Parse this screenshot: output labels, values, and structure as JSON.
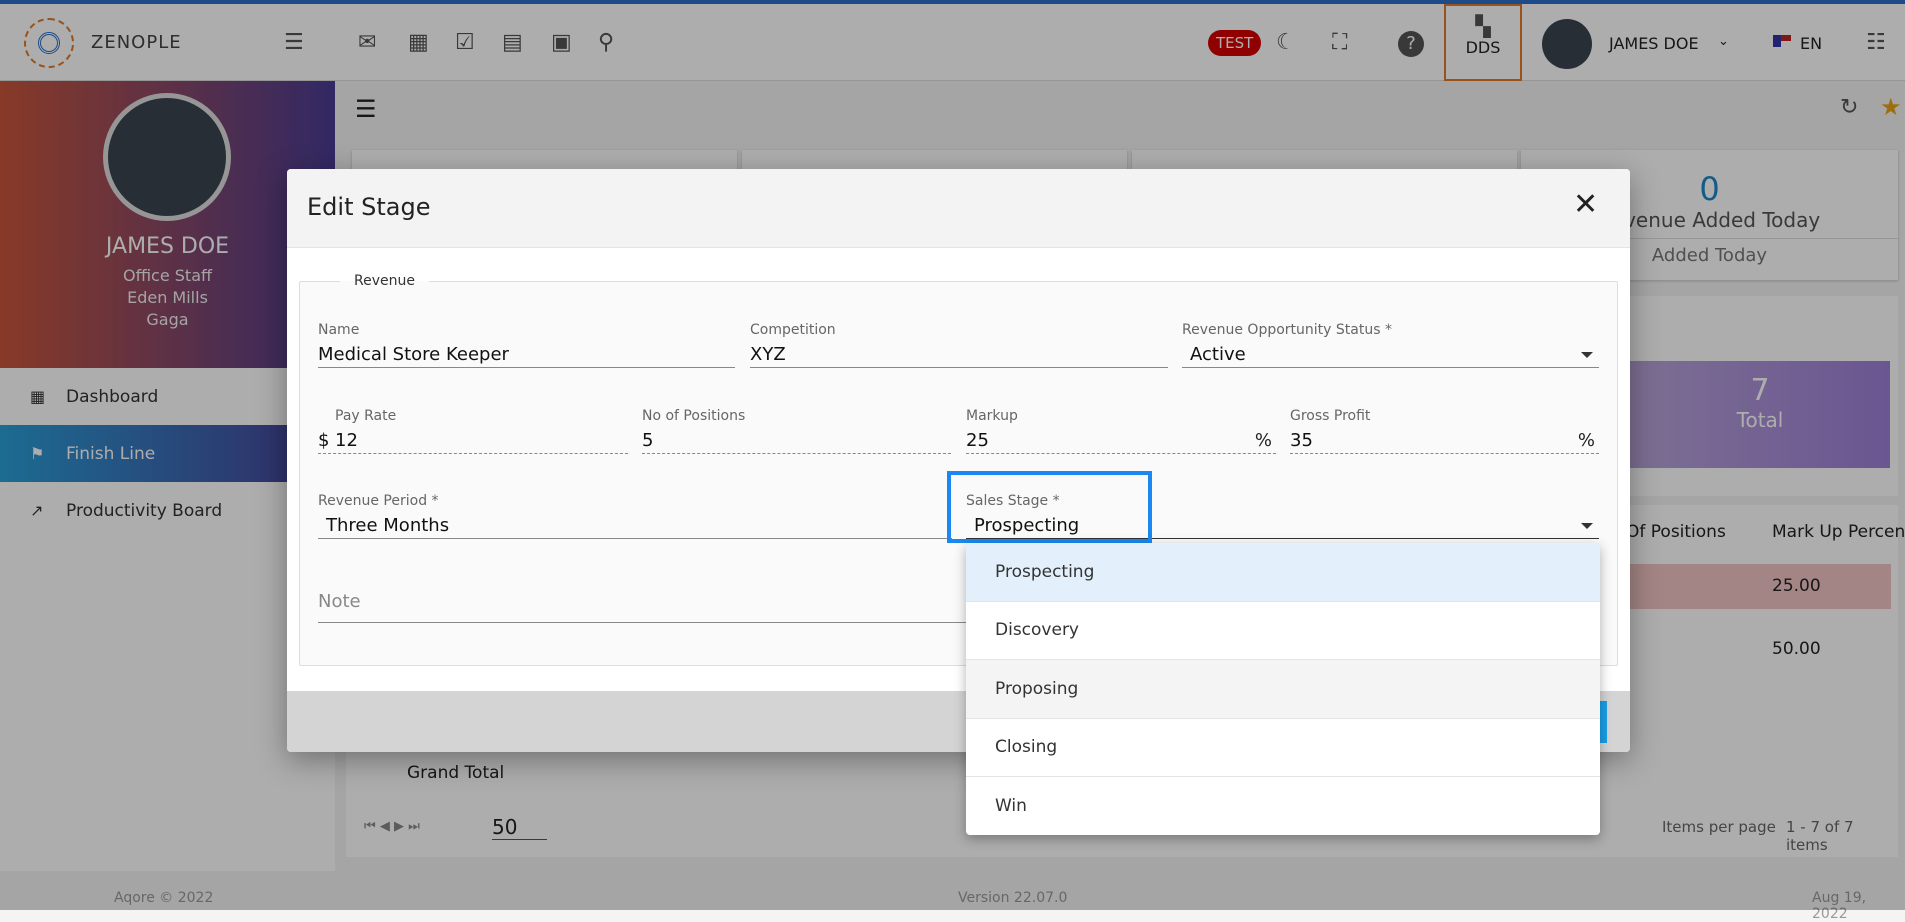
{
  "header": {
    "brand": "ZENOPLE",
    "test_badge": "TEST",
    "dds_label": "DDS",
    "user_name": "JAMES DOE",
    "language": "EN",
    "icons": [
      "mail-icon",
      "calculator-icon",
      "checkbox-icon",
      "chat-icon",
      "calendar-icon",
      "search-icon"
    ]
  },
  "profile": {
    "name": "JAMES DOE",
    "role": "Office Staff",
    "location": "Eden Mills",
    "company": "Gaga"
  },
  "sidebar": {
    "items": [
      {
        "label": "Dashboard",
        "icon": "dashboard-icon"
      },
      {
        "label": "Finish Line",
        "icon": "flag-icon",
        "active": true
      },
      {
        "label": "Productivity Board",
        "icon": "trending-icon"
      }
    ]
  },
  "cards": {
    "revenue_count": "0",
    "revenue_title": "Revenue Added Today",
    "revenue_sub": "Added Today"
  },
  "funnel": {
    "total_value": "7",
    "total_label": "Total"
  },
  "table": {
    "headers": [
      "Of Positions",
      "Mark Up Percent"
    ],
    "rows": [
      "25.00",
      "50.00"
    ],
    "grand_total": "Grand Total",
    "page_size": "50",
    "items_per_page": "Items per page",
    "range": "1 - 7 of 7 items"
  },
  "footer": {
    "copyright": "Aqore © 2022",
    "version": "Version 22.07.0",
    "date": "Aug 19, 2022"
  },
  "modal": {
    "title": "Edit Stage",
    "legend": "Revenue",
    "fields": {
      "name": {
        "label": "Name",
        "value": "Medical Store Keeper"
      },
      "competition": {
        "label": "Competition",
        "value": "XYZ"
      },
      "status": {
        "label": "Revenue Opportunity Status *",
        "value": "Active"
      },
      "pay_rate": {
        "label": "Pay Rate",
        "prefix": "$",
        "value": "12"
      },
      "positions": {
        "label": "No of Positions",
        "value": "5"
      },
      "markup": {
        "label": "Markup",
        "value": "25",
        "suffix": "%"
      },
      "gross_profit": {
        "label": "Gross Profit",
        "value": "35",
        "suffix": "%"
      },
      "revenue_period": {
        "label": "Revenue Period *",
        "value": "Three Months"
      },
      "sales_stage": {
        "label": "Sales Stage *",
        "value": "Prospecting"
      },
      "note": {
        "placeholder": "Note"
      }
    },
    "sales_stage_options": [
      "Prospecting",
      "Discovery",
      "Proposing",
      "Closing",
      "Win"
    ]
  },
  "colors": {
    "accent": "#1a88f0",
    "brand_orange": "#e07b2a",
    "test_red": "#d40000"
  }
}
